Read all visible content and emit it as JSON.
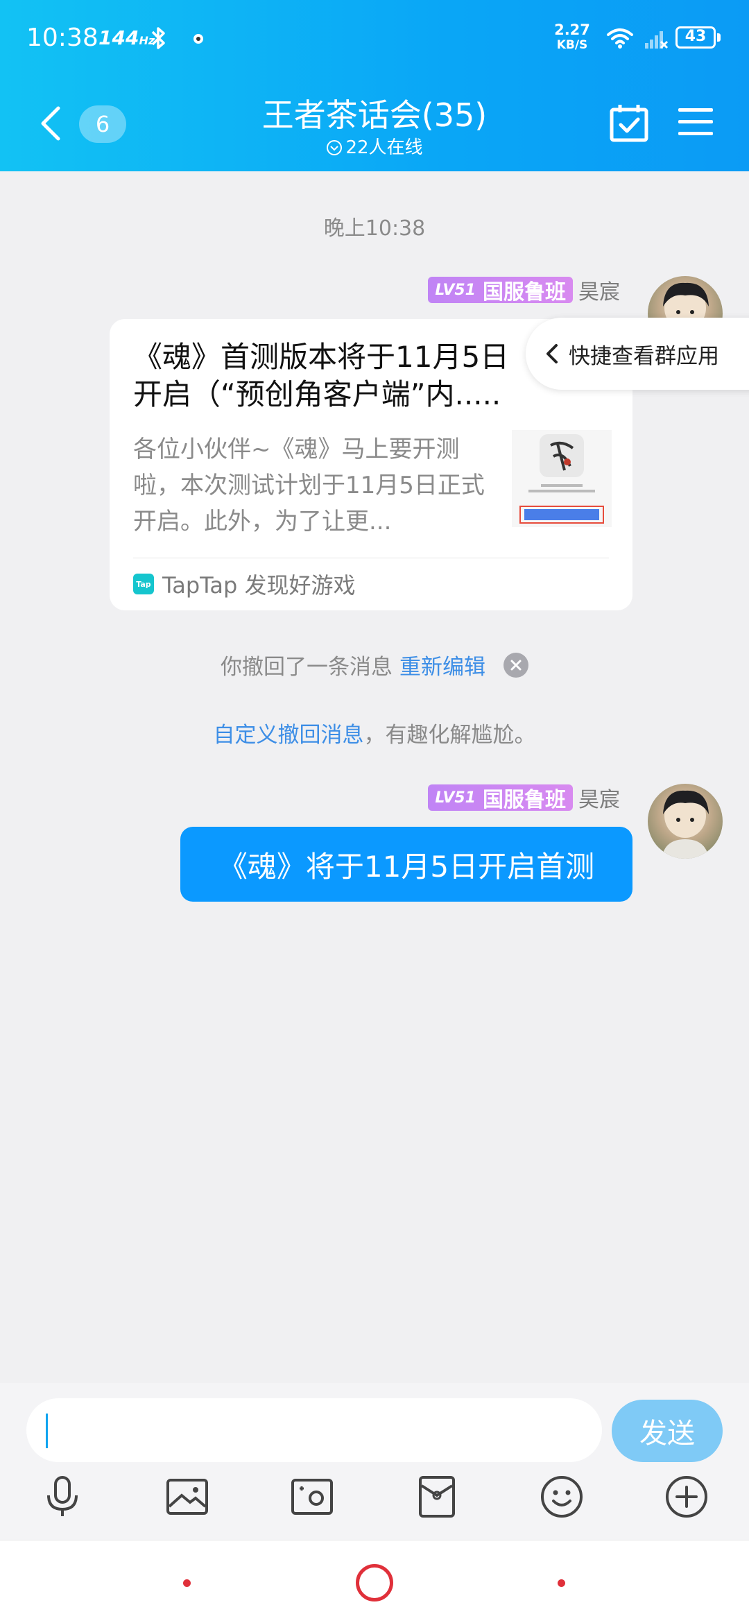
{
  "status_bar": {
    "time": "10:38",
    "refresh_rate": "144",
    "refresh_unit": "Hz",
    "net_speed_value": "2.27",
    "net_speed_unit": "KB/S",
    "battery": "43"
  },
  "header": {
    "unread_count": "6",
    "group_title": "王者茶话会(35)",
    "online_text": "22人在线"
  },
  "chat": {
    "timestamp": "晚上10:38",
    "messages": [
      {
        "level": "LV51",
        "honor": "国服鲁班",
        "sender": "昊宸",
        "card": {
          "title": "《魂》首测版本将于11月5日开启（“预创角客户端”内.....",
          "description": "各位小伙伴~《魂》马上要开测啦，本次测试计划于11月5日正式开启。此外，为了让更...",
          "source_logo": "Tap",
          "source": "TapTap 发现好游戏"
        }
      },
      {
        "level": "LV51",
        "honor": "国服鲁班",
        "sender": "昊宸",
        "text": "《魂》将于11月5日开启首测"
      }
    ],
    "quick_view": "快捷查看群应用",
    "recall_notice": "你撤回了一条消息",
    "reedit": "重新编辑",
    "custom_recall_link": "自定义撤回消息",
    "custom_recall_rest": "，有趣化解尴尬。"
  },
  "input": {
    "placeholder": "",
    "send_label": "发送"
  },
  "toolbar_icons": [
    "microphone-icon",
    "picture-icon",
    "camera-icon",
    "red-packet-icon",
    "emoji-icon",
    "plus-icon"
  ],
  "colors": {
    "header_start": "#12c2f4",
    "header_end": "#0b9bf5",
    "bubble": "#0b99ff",
    "link": "#3d8ee6",
    "level_badge": "#c084f5",
    "send_button": "#7fcaf6",
    "nav_accent": "#e0303a"
  }
}
